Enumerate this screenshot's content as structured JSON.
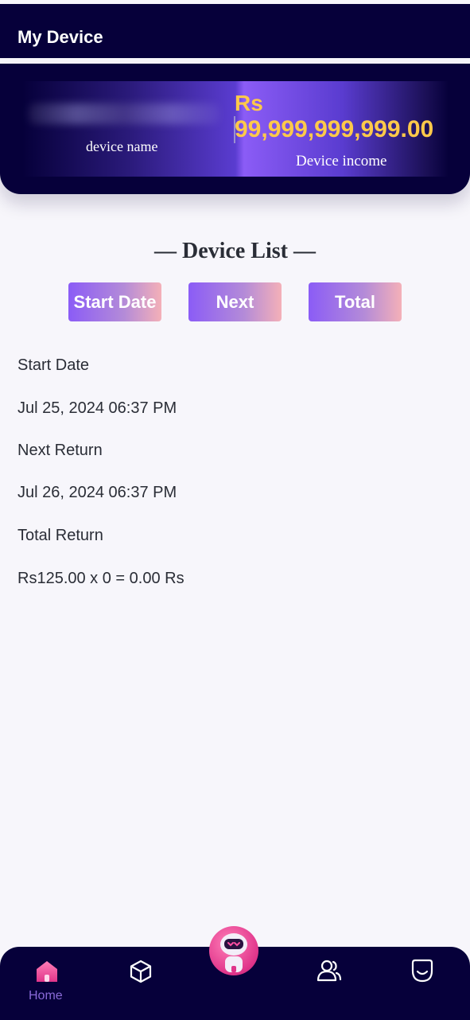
{
  "header": {
    "title": "My Device"
  },
  "device_card": {
    "name_label": "device name",
    "currency": "Rs",
    "income_amount": "99,999,999,999.00",
    "income_label": "Device income"
  },
  "device_list": {
    "title": "— Device List —",
    "buttons": [
      "Start Date",
      "Next",
      "Total"
    ]
  },
  "details": {
    "start_label": "Start Date",
    "start_value": "Jul 25, 2024 06:37 PM",
    "next_label": "Next Return",
    "next_value": "Jul 26, 2024 06:37 PM",
    "total_label": "Total Return",
    "total_value": "Rs125.00 x 0 = 0.00 Rs"
  },
  "bottom_nav": {
    "items": [
      {
        "label": "Home",
        "icon": "home-icon",
        "active": true
      },
      {
        "label": "",
        "icon": "cube-icon"
      },
      {
        "label": "",
        "icon": "robot-avatar"
      },
      {
        "label": "",
        "icon": "users-icon"
      },
      {
        "label": "",
        "icon": "smile-icon"
      }
    ],
    "active_color": "#8a6ad8",
    "accent_color": "#e0348a"
  },
  "colors": {
    "navy": "#06003a",
    "gold": "#ffc94a",
    "purple": "#8b5cf6",
    "pink": "#f4b0b8"
  }
}
